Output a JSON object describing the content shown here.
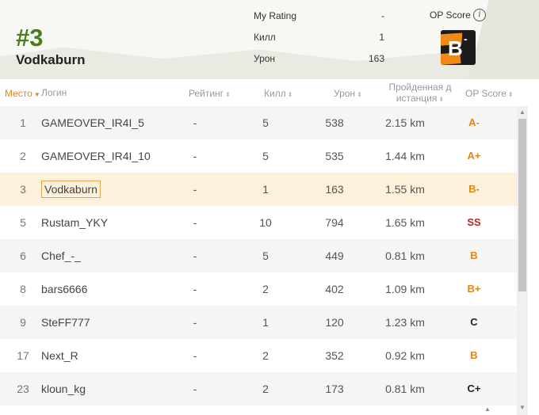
{
  "header": {
    "rank": "#3",
    "player_name": "Vodkaburn",
    "stats": [
      {
        "label": "My Rating",
        "value": "-"
      },
      {
        "label": "Килл",
        "value": "1"
      },
      {
        "label": "Урон",
        "value": "163"
      }
    ],
    "op_score_label": "OP Score",
    "info_glyph": "i",
    "badge_letter": "B",
    "badge_modifier": "-",
    "colors": {
      "rank": "#4d7c1e",
      "badge_bg": "#1b1b1b",
      "badge_accent": "#ef8a17"
    }
  },
  "table": {
    "columns": {
      "place": "Место",
      "login": "Логин",
      "rating": "Рейтинг",
      "kills": "Килл",
      "damage": "Урон",
      "distance": "Пройденная дистанция",
      "distance_line1": "Пройденная д",
      "distance_line2": "истанция",
      "op": "OP Score"
    },
    "sort_glyph_active": "▼",
    "sort_glyph": "⬍",
    "rows": [
      {
        "place": "1",
        "login": "GAMEOVER_IR4I_5",
        "rating": "-",
        "kills": "5",
        "damage": "538",
        "distance": "2.15 km",
        "op": "A-",
        "op_color": "#e58414"
      },
      {
        "place": "2",
        "login": "GAMEOVER_IR4I_10",
        "rating": "-",
        "kills": "5",
        "damage": "535",
        "distance": "1.44 km",
        "op": "A+",
        "op_color": "#e58414"
      },
      {
        "place": "3",
        "login": "Vodkaburn",
        "rating": "-",
        "kills": "1",
        "damage": "163",
        "distance": "1.55 km",
        "op": "B-",
        "op_color": "#e58414"
      },
      {
        "place": "5",
        "login": "Rustam_YKY",
        "rating": "-",
        "kills": "10",
        "damage": "794",
        "distance": "1.65 km",
        "op": "SS",
        "op_color": "#b22a1e"
      },
      {
        "place": "6",
        "login": "Chef_-_",
        "rating": "-",
        "kills": "5",
        "damage": "449",
        "distance": "0.81 km",
        "op": "B",
        "op_color": "#e58414"
      },
      {
        "place": "8",
        "login": "bars6666",
        "rating": "-",
        "kills": "2",
        "damage": "402",
        "distance": "1.09 km",
        "op": "B+",
        "op_color": "#e58414"
      },
      {
        "place": "9",
        "login": "SteFF777",
        "rating": "-",
        "kills": "1",
        "damage": "120",
        "distance": "1.23 km",
        "op": "C",
        "op_color": "#222222"
      },
      {
        "place": "17",
        "login": "Next_R",
        "rating": "-",
        "kills": "2",
        "damage": "352",
        "distance": "0.92 km",
        "op": "B",
        "op_color": "#e58414"
      },
      {
        "place": "23",
        "login": "kloun_kg",
        "rating": "-",
        "kills": "2",
        "damage": "173",
        "distance": "0.81 km",
        "op": "C+",
        "op_color": "#222222"
      }
    ]
  }
}
